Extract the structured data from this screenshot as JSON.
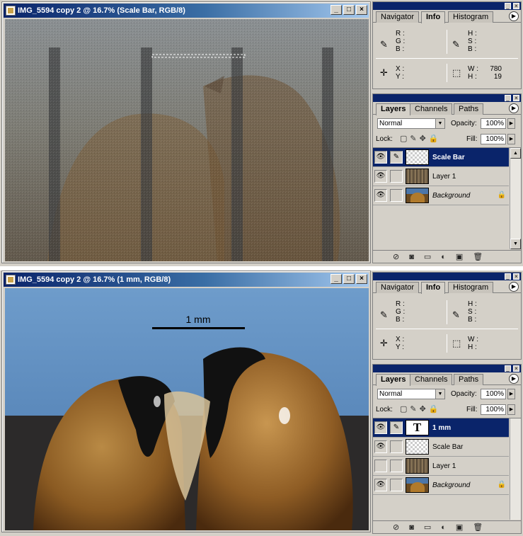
{
  "top": {
    "doc_title": "IMG_5594 copy 2 @ 16.7% (Scale Bar, RGB/8)",
    "info_tabs": [
      "Navigator",
      "Info",
      "Histogram"
    ],
    "info_active": "Info",
    "info": {
      "rgb_labels": [
        "R :",
        "G :",
        "B :"
      ],
      "hsb_labels": [
        "H :",
        "S :",
        "B :"
      ],
      "xy_labels": [
        "X :",
        "Y :"
      ],
      "wh_labels": [
        "W :",
        "H :"
      ],
      "w_value": "780",
      "h_value": "19"
    },
    "layer_tabs": [
      "Layers",
      "Channels",
      "Paths"
    ],
    "layer_active": "Layers",
    "blend_mode": "Normal",
    "opacity_label": "Opacity:",
    "opacity_value": "100%",
    "lock_label": "Lock:",
    "fill_label": "Fill:",
    "fill_value": "100%",
    "layers": [
      {
        "name": "Scale Bar",
        "thumb": "checker",
        "selected": true,
        "visible": true
      },
      {
        "name": "Layer 1",
        "thumb": "wood",
        "selected": false,
        "visible": true
      },
      {
        "name": "Background",
        "thumb": "bg",
        "selected": false,
        "visible": true,
        "locked": true
      }
    ]
  },
  "bottom": {
    "doc_title": "IMG_5594 copy 2 @ 16.7% (1 mm, RGB/8)",
    "scale_label": "1 mm",
    "info_tabs": [
      "Navigator",
      "Info",
      "Histogram"
    ],
    "info_active": "Info",
    "info": {
      "rgb_labels": [
        "R :",
        "G :",
        "B :"
      ],
      "hsb_labels": [
        "H :",
        "S :",
        "B :"
      ],
      "xy_labels": [
        "X :",
        "Y :"
      ],
      "wh_labels": [
        "W :",
        "H :"
      ]
    },
    "layer_tabs": [
      "Layers",
      "Channels",
      "Paths"
    ],
    "layer_active": "Layers",
    "blend_mode": "Normal",
    "opacity_label": "Opacity:",
    "opacity_value": "100%",
    "lock_label": "Lock:",
    "fill_label": "Fill:",
    "fill_value": "100%",
    "layers": [
      {
        "name": "1 mm",
        "thumb": "text",
        "thumb_glyph": "T",
        "selected": true,
        "visible": true
      },
      {
        "name": "Scale Bar",
        "thumb": "checker",
        "selected": false,
        "visible": true
      },
      {
        "name": "Layer 1",
        "thumb": "wood",
        "selected": false,
        "visible": false
      },
      {
        "name": "Background",
        "thumb": "bg",
        "selected": false,
        "visible": true,
        "locked": true
      }
    ]
  },
  "window_buttons": {
    "minimize": "_",
    "maximize": "□",
    "close": "×"
  },
  "colors": {
    "titlebar": "#0a246a",
    "selected_layer": "#0a246a",
    "panel": "#d4d0c8"
  }
}
